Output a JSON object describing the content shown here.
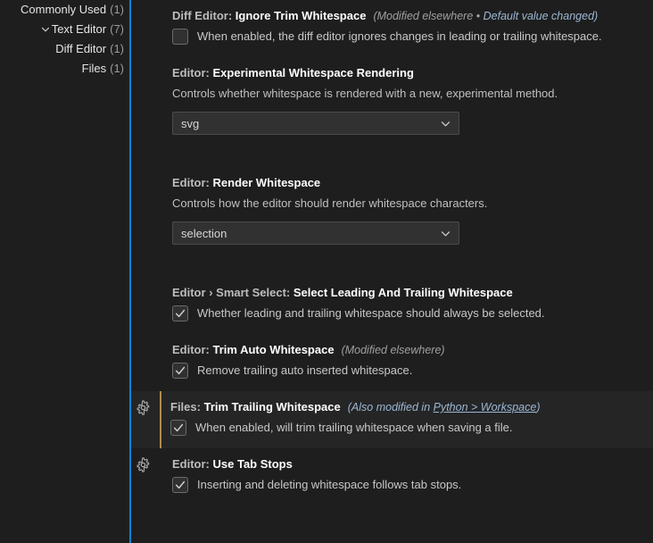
{
  "theme": {
    "background": "#1e1e1e",
    "highlight_row_background": "#252526",
    "focus_border": "#0a84d8",
    "modified_indicator": "#b08c4f",
    "text": "#cccccc",
    "title_name": "#ffffff",
    "link": "#9cb7d4"
  },
  "toc": {
    "items": [
      {
        "label": "Commonly Used",
        "count": "(1)",
        "indent": 1,
        "twisty": "none"
      },
      {
        "label": "Text Editor",
        "count": "(7)",
        "indent": 0,
        "twisty": "chevron-down-icon"
      },
      {
        "label": "Diff Editor",
        "count": "(1)",
        "indent": 2,
        "twisty": "none"
      },
      {
        "label": "Files",
        "count": "(1)",
        "indent": 2,
        "twisty": "none"
      }
    ]
  },
  "settings": [
    {
      "id": "diffEditor.ignoreTrimWhitespace",
      "category": "Diff Editor:",
      "name": "Ignore Trim Whitespace",
      "separator": "",
      "tags": [
        {
          "text": "(Modified elsewhere",
          "style": "gray"
        },
        {
          "text": " • ",
          "style": "dot"
        },
        {
          "text": "Default value changed)",
          "style": "blue"
        }
      ],
      "control": "checkbox",
      "checked": false,
      "checkbox_label": "When enabled, the diff editor ignores changes in leading or trailing whitespace.",
      "description": "",
      "modified": false,
      "gear": false,
      "highlight": false
    },
    {
      "id": "editor.experimentalWhitespaceRendering",
      "category": "Editor:",
      "name": "Experimental Whitespace Rendering",
      "separator": "",
      "tags": [],
      "control": "select",
      "select_value": "svg",
      "checkbox_label": "",
      "description": "Controls whether whitespace is rendered with a new, experimental method.",
      "modified": false,
      "gear": false,
      "highlight": false
    },
    {
      "id": "editor.renderWhitespace",
      "category": "Editor:",
      "name": "Render Whitespace",
      "separator": "",
      "tags": [],
      "control": "select",
      "select_value": "selection",
      "checkbox_label": "",
      "description": "Controls how the editor should render whitespace characters.",
      "modified": false,
      "gear": false,
      "highlight": false
    },
    {
      "id": "editor.smartSelect.selectLeadingAndTrailingWhitespace",
      "category": "Editor",
      "separator": "›",
      "subcategory": "Smart Select:",
      "name": "Select Leading And Trailing Whitespace",
      "tags": [],
      "control": "checkbox",
      "checked": true,
      "checkbox_label": "Whether leading and trailing whitespace should always be selected.",
      "description": "",
      "modified": false,
      "gear": false,
      "highlight": false
    },
    {
      "id": "editor.trimAutoWhitespace",
      "category": "Editor:",
      "name": "Trim Auto Whitespace",
      "separator": "",
      "tags": [
        {
          "text": "(Modified elsewhere)",
          "style": "gray"
        }
      ],
      "control": "checkbox",
      "checked": true,
      "checkbox_label": "Remove trailing auto inserted whitespace.",
      "description": "",
      "modified": false,
      "gear": false,
      "highlight": false
    },
    {
      "id": "files.trimTrailingWhitespace",
      "category": "Files:",
      "name": "Trim Trailing Whitespace",
      "separator": "",
      "tags": [
        {
          "text": "(Also modified in ",
          "style": "blue"
        },
        {
          "text": "Python > Workspace",
          "style": "link"
        },
        {
          "text": ")",
          "style": "blue"
        }
      ],
      "control": "checkbox",
      "checked": true,
      "checkbox_label": "When enabled, will trim trailing whitespace when saving a file.",
      "description": "",
      "modified": true,
      "gear": true,
      "highlight": true
    },
    {
      "id": "editor.useTabStops",
      "category": "Editor:",
      "name": "Use Tab Stops",
      "separator": "",
      "tags": [],
      "control": "checkbox",
      "checked": true,
      "checkbox_label": "Inserting and deleting whitespace follows tab stops.",
      "description": "",
      "modified": false,
      "gear": true,
      "highlight": false
    }
  ]
}
